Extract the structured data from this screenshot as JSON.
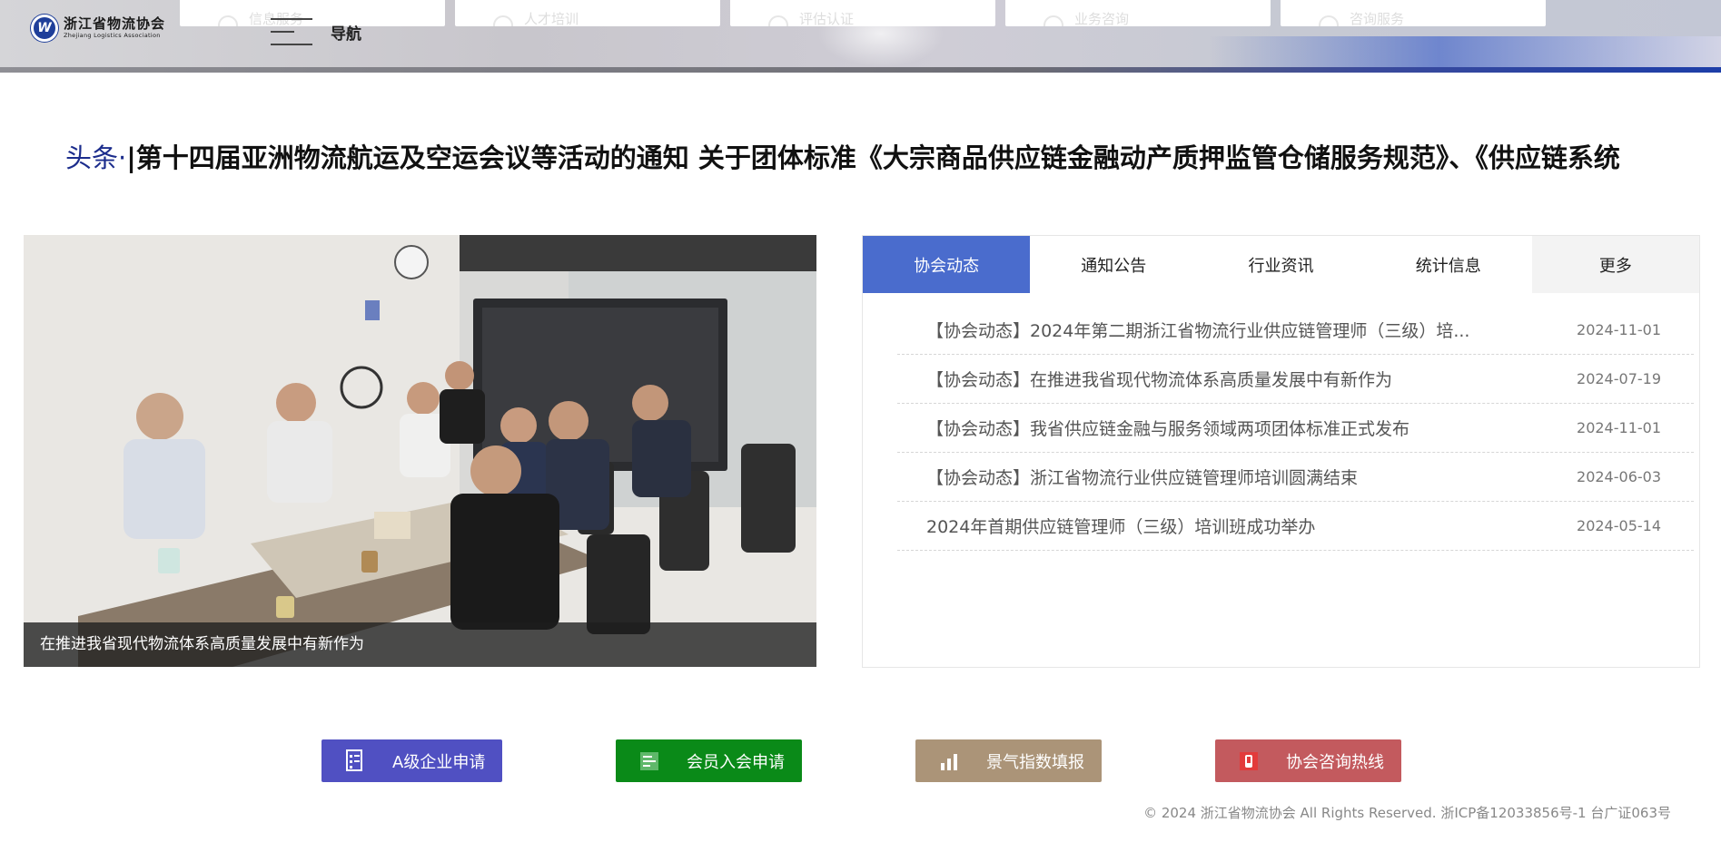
{
  "header": {
    "logo_cn": "浙江省物流协会",
    "logo_en": "Zhejiang Logistics Association",
    "logo_mark": "W",
    "nav_label": "导航",
    "top_cards": [
      "信息服务",
      "人才培训",
      "评估认证",
      "业务咨询",
      "咨询服务"
    ]
  },
  "headline": {
    "label": "头条·",
    "text": "|第十四届亚洲物流航运及空运会议等活动的通知 关于团体标准《大宗商品供应链金融动产质押监管仓储服务规范》、《供应链系统"
  },
  "photo": {
    "caption": "在推进我省现代物流体系高质量发展中有新作为"
  },
  "news": {
    "tabs": [
      {
        "label": "协会动态",
        "active": true
      },
      {
        "label": "通知公告",
        "active": false
      },
      {
        "label": "行业资讯",
        "active": false
      },
      {
        "label": "统计信息",
        "active": false
      },
      {
        "label": "更多",
        "active": false
      }
    ],
    "items": [
      {
        "title": "【协会动态】2024年第二期浙江省物流行业供应链管理师（三级）培...",
        "date": "2024-11-01"
      },
      {
        "title": "【协会动态】在推进我省现代物流体系高质量发展中有新作为",
        "date": "2024-07-19"
      },
      {
        "title": "【协会动态】我省供应链金融与服务领域两项团体标准正式发布",
        "date": "2024-11-01"
      },
      {
        "title": "【协会动态】浙江省物流行业供应链管理师培训圆满结束",
        "date": "2024-06-03"
      },
      {
        "title": "2024年首期供应链管理师（三级）培训班成功举办",
        "date": "2024-05-14"
      }
    ]
  },
  "quick_links": [
    {
      "label": "A级企业申请",
      "icon": "document-list-icon",
      "color": "#5050c2"
    },
    {
      "label": "会员入会申请",
      "icon": "form-icon",
      "color": "#0a8a18"
    },
    {
      "label": "景气指数填报",
      "icon": "bar-chart-icon",
      "color": "#ab9478"
    },
    {
      "label": "协会咨询热线",
      "icon": "phone-icon",
      "color": "#c35a5e"
    }
  ],
  "footer": {
    "text": "© 2024 浙江省物流协会  All Rights Reserved.   浙ICP备12033856号-1 台广证063号"
  }
}
